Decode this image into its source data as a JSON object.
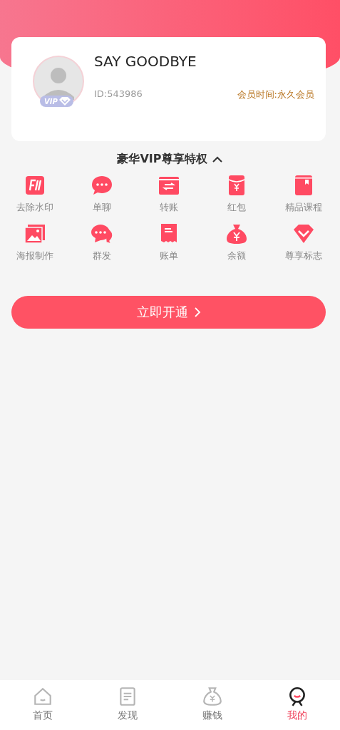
{
  "profile": {
    "name": "SAY GOODBYE",
    "badge": "VIP",
    "id": "ID:543986",
    "membership": "会员时间:永久会员"
  },
  "privileges": {
    "title": "豪华VIP尊享特权",
    "expanded": true,
    "items": [
      {
        "label": "去除水印"
      },
      {
        "label": "单聊"
      },
      {
        "label": "转账"
      },
      {
        "label": "红包"
      },
      {
        "label": "精品课程"
      },
      {
        "label": "海报制作"
      },
      {
        "label": "群发"
      },
      {
        "label": "账单"
      },
      {
        "label": "余额"
      },
      {
        "label": "尊享标志"
      }
    ]
  },
  "action": {
    "label": "立即开通"
  },
  "tabs": [
    {
      "label": "首页",
      "selected": false
    },
    {
      "label": "发现",
      "selected": false
    },
    {
      "label": "赚钱",
      "selected": false
    },
    {
      "label": "我的",
      "selected": true
    }
  ]
}
